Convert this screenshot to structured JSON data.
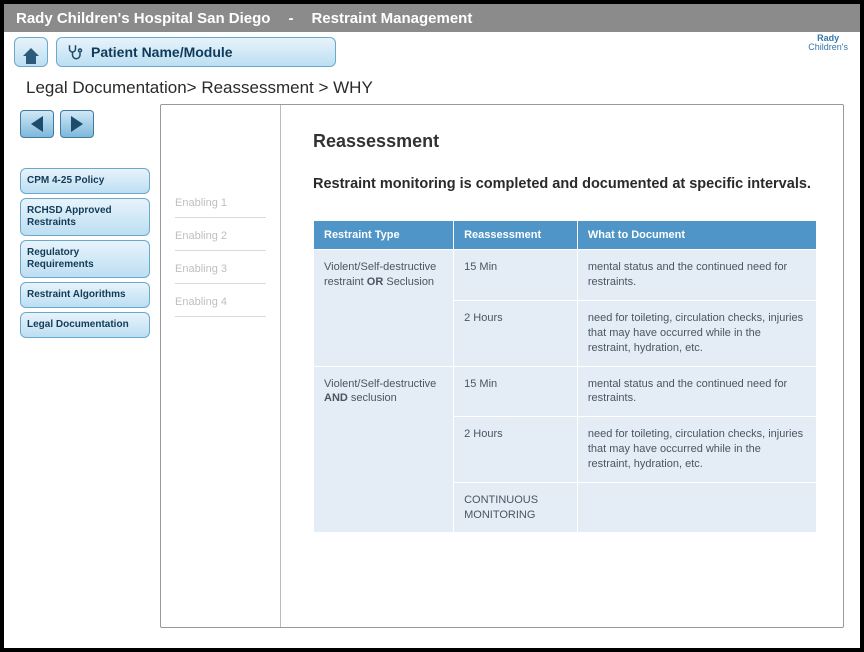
{
  "titlebar": {
    "org": "Rady Children's Hospital San Diego",
    "section": "Restraint Management"
  },
  "navbar": {
    "patient_label": "Patient Name/Module",
    "logo_line1": "Rady",
    "logo_line2": "Children's"
  },
  "breadcrumb": "Legal Documentation> Reassessment > WHY",
  "sidebar": {
    "items": [
      {
        "label": "CPM 4-25 Policy"
      },
      {
        "label": "RCHSD Approved Restraints"
      },
      {
        "label": "Regulatory Requirements"
      },
      {
        "label": "Restraint Algorithms"
      },
      {
        "label": "Legal Documentation"
      }
    ]
  },
  "enabling": {
    "items": [
      {
        "label": "Enabling 1"
      },
      {
        "label": "Enabling 2"
      },
      {
        "label": "Enabling 3"
      },
      {
        "label": "Enabling 4"
      }
    ]
  },
  "doc": {
    "title": "Reassessment",
    "intro": "Restraint monitoring is completed and documented at specific intervals.",
    "table": {
      "headers": [
        "Restraint Type",
        "Reassessment",
        "What to Document"
      ],
      "rows": [
        {
          "type_prefix": "Violent/Self-destructive restraint ",
          "type_bold": "OR",
          "type_suffix": " Seclusion",
          "interval": "15 Min",
          "doc": "mental status and the continued need for restraints."
        },
        {
          "type_prefix": "",
          "type_bold": "",
          "type_suffix": "",
          "interval": "2 Hours",
          "doc": "need for toileting, circulation checks, injuries that may have occurred while in the restraint, hydration, etc."
        },
        {
          "type_prefix": "Violent/Self-destructive ",
          "type_bold": "AND",
          "type_suffix": " seclusion",
          "interval": "15 Min",
          "doc": "mental status and the continued need for restraints."
        },
        {
          "type_prefix": "",
          "type_bold": "",
          "type_suffix": "",
          "interval": "2 Hours",
          "doc": "need for toileting, circulation checks, injuries that may have occurred while in the restraint, hydration, etc."
        },
        {
          "type_prefix": "",
          "type_bold": "",
          "type_suffix": "",
          "interval": "CONTINUOUS MONITORING",
          "doc": ""
        }
      ]
    }
  }
}
